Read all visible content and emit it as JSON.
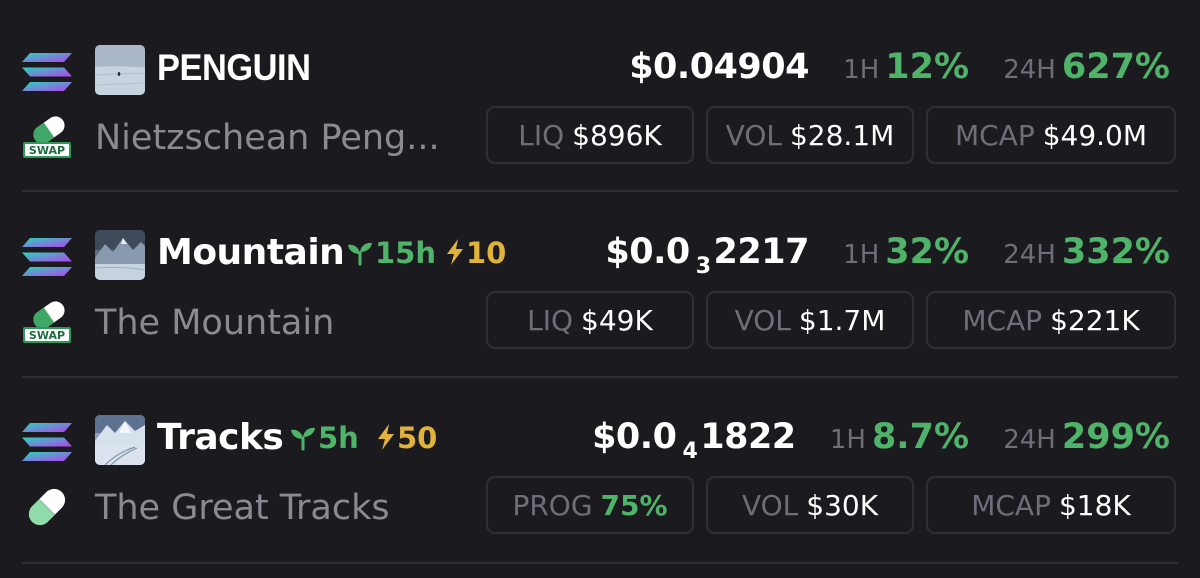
{
  "colors": {
    "background": "#1b1b1f",
    "positive": "#4fb46a",
    "boost": "#e0b43a",
    "muted": "#6e6e78",
    "box_border": "#2f2f36"
  },
  "tokens": [
    {
      "symbol": "PENGUIN",
      "name": "Nietzschean Peng...",
      "age": "",
      "boost": "",
      "price_main": "$0.04904",
      "price_zero_count": "",
      "price_tail": "",
      "h1_label": "1H",
      "h1_change": "12%",
      "h24_label": "24H",
      "h24_change": "627%",
      "stat1_label": "LIQ",
      "stat1_value": "$896K",
      "stat2_label": "VOL",
      "stat2_value": "$28.1M",
      "stat3_label": "MCAP",
      "stat3_value": "$49.0M",
      "chain_icon": "solana-icon",
      "dex_icon": "swap-pill-icon"
    },
    {
      "symbol": "Mountain",
      "name": "The Mountain",
      "age": "15h",
      "boost": "10",
      "price_main": "$0.0",
      "price_zero_count": "3",
      "price_tail": "2217",
      "h1_label": "1H",
      "h1_change": "32%",
      "h24_label": "24H",
      "h24_change": "332%",
      "stat1_label": "LIQ",
      "stat1_value": "$49K",
      "stat2_label": "VOL",
      "stat2_value": "$1.7M",
      "stat3_label": "MCAP",
      "stat3_value": "$221K",
      "chain_icon": "solana-icon",
      "dex_icon": "swap-pill-icon"
    },
    {
      "symbol": "Tracks",
      "name": "The Great Tracks",
      "age": "5h",
      "boost": "50",
      "price_main": "$0.0",
      "price_zero_count": "4",
      "price_tail": "1822",
      "h1_label": "1H",
      "h1_change": "8.7%",
      "h24_label": "24H",
      "h24_change": "299%",
      "stat1_label": "PROG",
      "stat1_value": "75%",
      "stat2_label": "VOL",
      "stat2_value": "$30K",
      "stat3_label": "MCAP",
      "stat3_value": "$18K",
      "chain_icon": "solana-icon",
      "dex_icon": "pill-icon"
    }
  ]
}
